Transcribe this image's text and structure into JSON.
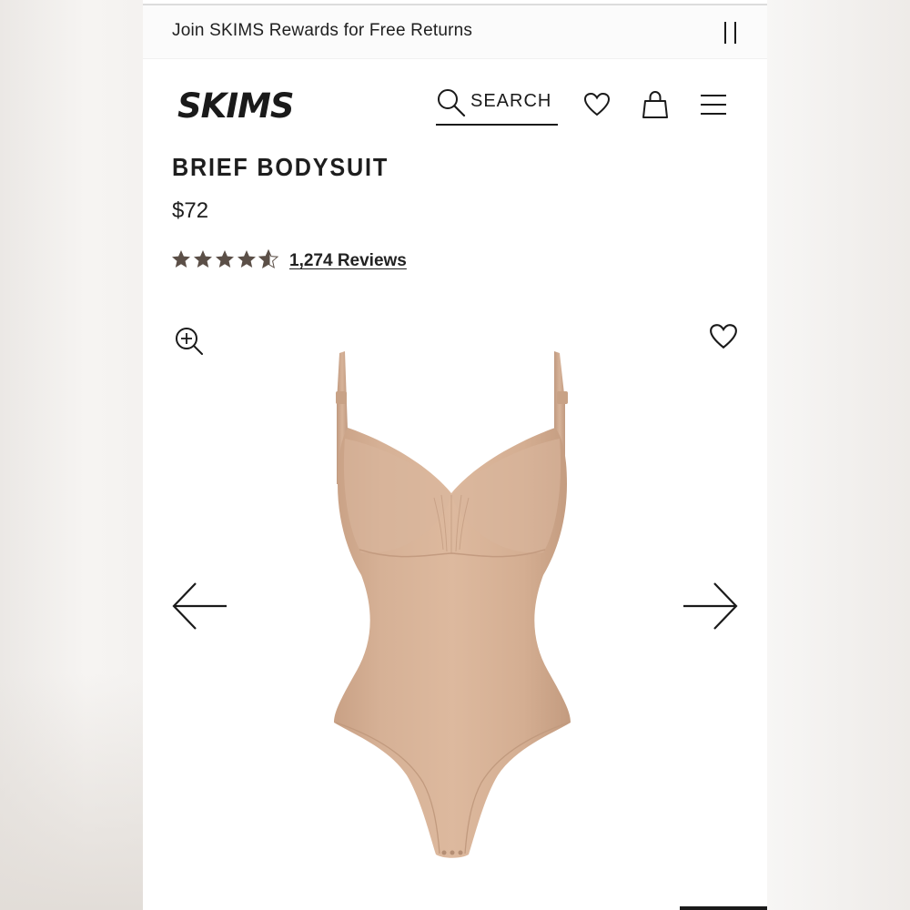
{
  "banner": {
    "text": "Join SKIMS Rewards for Free Returns",
    "pause_icon": "pause-icon"
  },
  "header": {
    "logo": "SKIMS",
    "search_label": "SEARCH",
    "icons": [
      "search-icon",
      "heart-icon",
      "shopping-bag-icon",
      "hamburger-menu-icon"
    ]
  },
  "product": {
    "title": "BRIEF BODYSUIT",
    "price": "$72",
    "rating": 4.5,
    "rating_max": 5,
    "reviews_label": "1,274 Reviews",
    "image_description": "nude bodysuit product photo",
    "color": "#d4ae92"
  },
  "gallery": {
    "icons": [
      "zoom-in-icon",
      "heart-icon",
      "arrow-left-icon",
      "arrow-right-icon"
    ]
  },
  "colors": {
    "star": "#5b4f47",
    "text": "#1a1a1a",
    "background": "#ffffff"
  }
}
